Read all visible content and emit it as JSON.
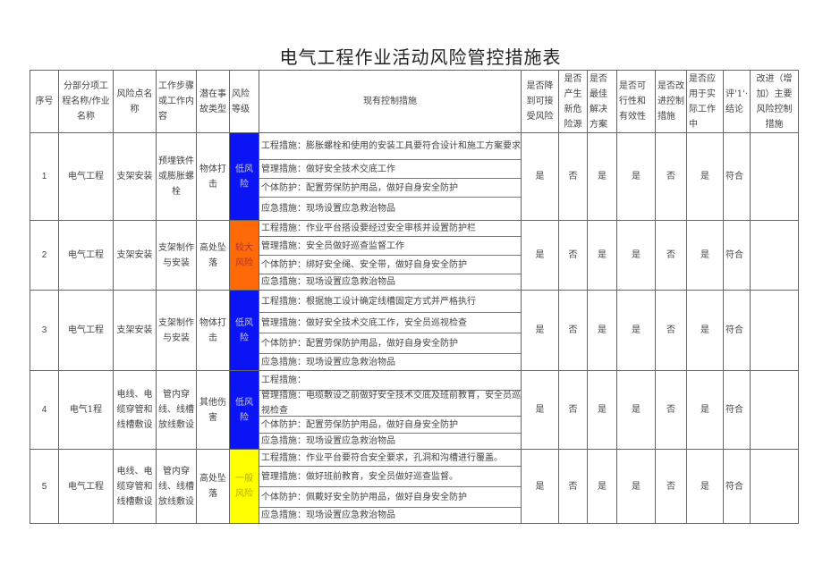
{
  "title": "电气工程作业活动风险管控措施表",
  "headers": {
    "seq": "序号",
    "project": "分部分项工程名称/作业名称",
    "risk_point": "风险点名称",
    "work_step": "工作步骤或工作内容",
    "accident_type": "潜在事故类型",
    "risk_level": "风险等级",
    "controls": "现有控制措施",
    "acceptable": "是否降到可接受风险",
    "new_hazard": "是否产生新危险源",
    "best_solution": "是否最佳解决方案",
    "feasible": "是否可行性和有效性",
    "improve": "是否改进控制措施",
    "applied": "是否应用于实际工作中",
    "eval": "评'1'·结论",
    "improvement": "改进（增加）主要风险控制措施"
  },
  "rows": [
    {
      "seq": "1",
      "project": "电气工程",
      "risk_point": "支架安装",
      "work_step": "预埋铁件或膨胀螺栓",
      "accident_type": "物体打击",
      "risk_level": "低风险",
      "risk_color": "#0a14f5",
      "controls": [
        "工程措施：膨胀螺栓和使用的安装工具要符合设计和施工方案要求",
        "管理措施：做好安全技术交底工作",
        "个体防护：配置劳保防护用品，做好自身安全防护",
        "应急措施：现场设置应急救治物品"
      ],
      "acceptable": "是",
      "new_hazard": "否",
      "best_solution": "是",
      "feasible": "是",
      "improve": "否",
      "applied": "是",
      "eval": "符合",
      "improvement": ""
    },
    {
      "seq": "2",
      "project": "电气工程",
      "risk_point": "支架安装",
      "work_step": "支架制作与安装",
      "accident_type": "高处坠落",
      "risk_level": "较大风险",
      "risk_color": "#ff6a08",
      "controls": [
        "工程措施：作业平台搭设要经过安全审核并设置防护栏",
        "管理措施：安全员做好巡查监督工作",
        "个体防护：绑好安全绳、安全带，做好自身安全防护",
        "应急措施：现场设置应急救治物品"
      ],
      "acceptable": "是",
      "new_hazard": "否",
      "best_solution": "是",
      "feasible": "是",
      "improve": "否",
      "applied": "是",
      "eval": "符合",
      "improvement": ""
    },
    {
      "seq": "3",
      "project": "电气工程",
      "risk_point": "支架安装",
      "work_step": "支架制作与安装",
      "accident_type": "物体打击",
      "risk_level": "低风险",
      "risk_color": "#0a14f5",
      "controls": [
        "工程措施：根据施工设计确定线槽固定方式并严格执行",
        "管理措施：做好安全技术交底工作，安全员巡视检查",
        "个体防护：配置劳保防护用品，做好自身安全防护",
        "应急措施：现场设置应急救治物品"
      ],
      "acceptable": "是",
      "new_hazard": "否",
      "best_solution": "是",
      "feasible": "是",
      "improve": "否",
      "applied": "是",
      "eval": "符合",
      "improvement": ""
    },
    {
      "seq": "4",
      "project": "电气1程",
      "risk_point": "电线、电缆穿管和线槽敷设",
      "work_step": "管内穿线、线槽放线敷设",
      "accident_type": "其他伤害",
      "risk_level": "低风险",
      "risk_color": "#0a14f5",
      "controls": [
        "工程措施：",
        "管理措施：电缆敷设之前做好安全技术交底及班前教育，安全员巡视检查",
        "个体防护：配置劳保防护用品，做好自身安全防护",
        "应急措施：现场设置应急救治物品"
      ],
      "acceptable": "是",
      "new_hazard": "否",
      "best_solution": "是",
      "feasible": "是",
      "improve": "否",
      "applied": "是",
      "eval": "符合",
      "improvement": ""
    },
    {
      "seq": "5",
      "project": "电气工程",
      "risk_point": "电线、电缆穿管和线槽敷设",
      "work_step": "管内穿线、线槽放线敷设",
      "accident_type": "高处坠落",
      "risk_level": "一般风险",
      "risk_color": "#ffff00",
      "controls": [
        "工程措施：作业平台要符合安全要求，孔洞和沟槽进行覆盖。",
        "管理措施：做好班前教育，安全员做好巡查监督。",
        "个体防护：佩戴好安全防护用品，做好自身安全防护",
        "应急措施：现场设置应急救治物品"
      ],
      "acceptable": "是",
      "new_hazard": "否",
      "best_solution": "是",
      "feasible": "是",
      "improve": "否",
      "applied": "是",
      "eval": "符合",
      "improvement": ""
    }
  ]
}
